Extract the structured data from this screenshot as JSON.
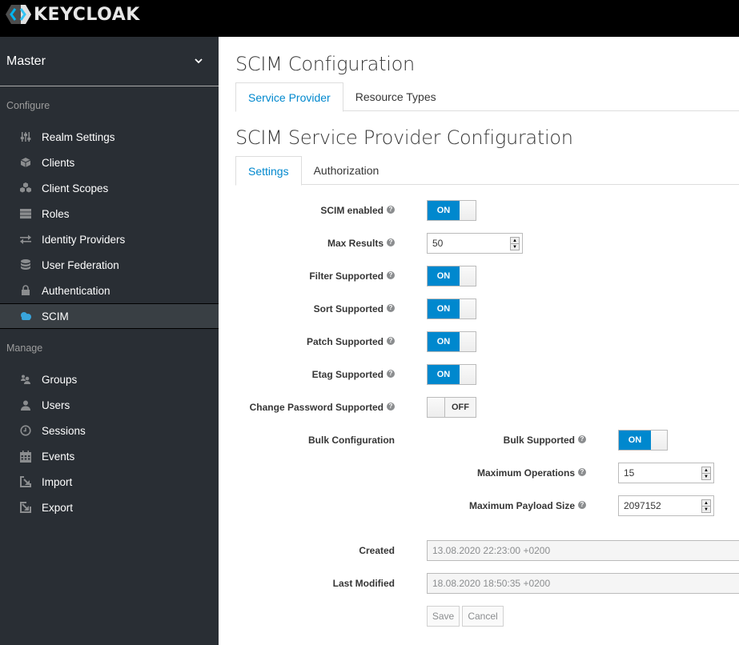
{
  "app": {
    "brand": "KEYCLOAK",
    "accent_color": "#0088ce"
  },
  "sidebar": {
    "realm": "Master",
    "configure_heading": "Configure",
    "configure_items": [
      {
        "label": "Realm Settings",
        "icon": "sliders-icon"
      },
      {
        "label": "Clients",
        "icon": "cube-icon"
      },
      {
        "label": "Client Scopes",
        "icon": "cubes-icon"
      },
      {
        "label": "Roles",
        "icon": "server-icon"
      },
      {
        "label": "Identity Providers",
        "icon": "exchange-icon"
      },
      {
        "label": "User Federation",
        "icon": "database-icon"
      },
      {
        "label": "Authentication",
        "icon": "lock-icon"
      },
      {
        "label": "SCIM",
        "icon": "cloud-icon",
        "active": true
      }
    ],
    "manage_heading": "Manage",
    "manage_items": [
      {
        "label": "Groups",
        "icon": "users-icon"
      },
      {
        "label": "Users",
        "icon": "user-icon"
      },
      {
        "label": "Sessions",
        "icon": "clock-icon"
      },
      {
        "label": "Events",
        "icon": "calendar-icon"
      },
      {
        "label": "Import",
        "icon": "import-icon"
      },
      {
        "label": "Export",
        "icon": "export-icon"
      }
    ]
  },
  "main": {
    "title": "SCIM Configuration",
    "tabs": [
      {
        "label": "Service Provider",
        "active": true
      },
      {
        "label": "Resource Types",
        "active": false
      }
    ],
    "subtitle": "SCIM Service Provider Configuration",
    "subtabs": [
      {
        "label": "Settings",
        "active": true
      },
      {
        "label": "Authorization",
        "active": false
      }
    ],
    "form": {
      "scim_enabled": {
        "label": "SCIM enabled",
        "value": "ON"
      },
      "max_results": {
        "label": "Max Results",
        "value": "50"
      },
      "filter_supported": {
        "label": "Filter Supported",
        "value": "ON"
      },
      "sort_supported": {
        "label": "Sort Supported",
        "value": "ON"
      },
      "patch_supported": {
        "label": "Patch Supported",
        "value": "ON"
      },
      "etag_supported": {
        "label": "Etag Supported",
        "value": "ON"
      },
      "change_password_supported": {
        "label": "Change Password Supported",
        "value": "OFF"
      },
      "bulk_configuration": {
        "label": "Bulk Configuration",
        "bulk_supported": {
          "label": "Bulk Supported",
          "value": "ON"
        },
        "max_operations": {
          "label": "Maximum Operations",
          "value": "15"
        },
        "max_payload_size": {
          "label": "Maximum Payload Size",
          "value": "2097152"
        }
      },
      "created": {
        "label": "Created",
        "value": "13.08.2020 22:23:00 +0200"
      },
      "last_modified": {
        "label": "Last Modified",
        "value": "18.08.2020 18:50:35 +0200"
      },
      "save_label": "Save",
      "cancel_label": "Cancel"
    }
  }
}
